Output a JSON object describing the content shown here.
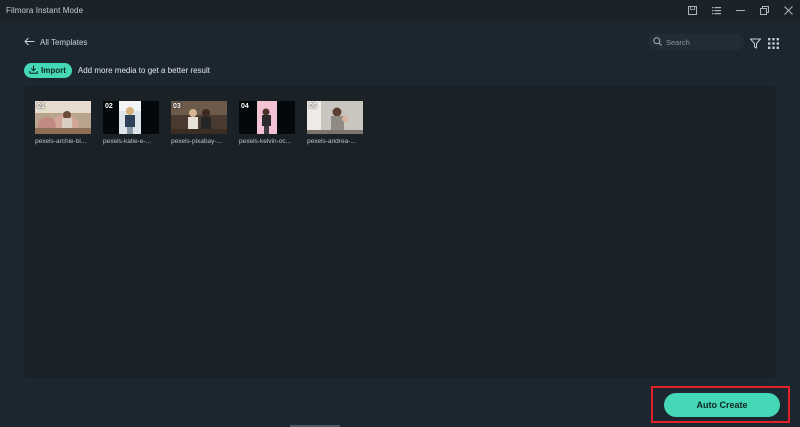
{
  "window": {
    "title": "Filmora Instant Mode",
    "controls": [
      "save-icon",
      "menu-list-icon",
      "minimize-icon",
      "restore-icon",
      "close-icon"
    ]
  },
  "nav": {
    "back_label": "All Templates"
  },
  "search": {
    "placeholder": "Search",
    "value": ""
  },
  "toolbar": {
    "filter_icon": "filter-icon",
    "grid_icon": "grid-view-icon"
  },
  "import": {
    "button_label": "Import",
    "hint": "Add more media to get a better result"
  },
  "media": {
    "clips": [
      {
        "number": "01",
        "name": "pexels-archie-bi..."
      },
      {
        "number": "02",
        "name": "pexels-katie-e-..."
      },
      {
        "number": "03",
        "name": "pexels-pixabay-..."
      },
      {
        "number": "04",
        "name": "pexels-kelvin-oc..."
      },
      {
        "number": "05",
        "name": "pexels-andrea-..."
      }
    ]
  },
  "actions": {
    "auto_create_label": "Auto Create"
  },
  "colors": {
    "accent": "#45d8b6",
    "background": "#1c262e",
    "panel": "#1a2228",
    "highlight_box": "#e0202a"
  }
}
